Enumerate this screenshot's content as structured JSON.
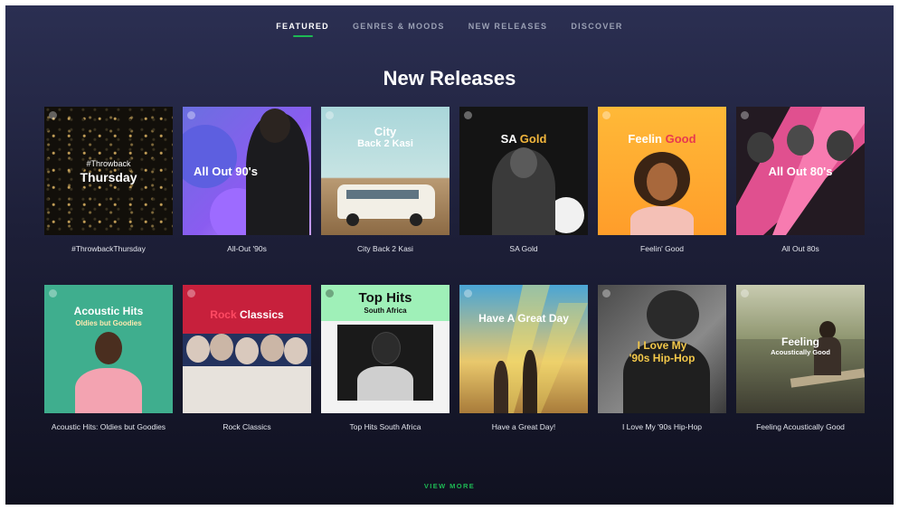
{
  "nav": {
    "items": [
      {
        "label": "FEATURED",
        "active": true
      },
      {
        "label": "GENRES & MOODS",
        "active": false
      },
      {
        "label": "NEW RELEASES",
        "active": false
      },
      {
        "label": "DISCOVER",
        "active": false
      }
    ]
  },
  "page": {
    "title": "New Releases",
    "view_more": "VIEW MORE"
  },
  "colors": {
    "accent": "#1db954",
    "background_top": "#2b2f52",
    "background_bottom": "#101120"
  },
  "covers": {
    "throwback_line1": "#Throwback",
    "throwback_line2": "Thursday",
    "allout90s": "All Out 90's",
    "city_line1": "City",
    "city_line2": "Back 2 Kasi",
    "sagold_a": "SA",
    "sagold_b": "Gold",
    "feelin_a": "Feelin",
    "feelin_b": "Good",
    "allout80s": "All Out 80's",
    "acoustic_line1": "Acoustic Hits",
    "acoustic_line2": "Oldies but Goodies",
    "rock_a": "Rock",
    "rock_b": "Classics",
    "tophits_line1": "Top Hits",
    "tophits_line2": "South Africa",
    "greatday": "Have A Great Day",
    "hiphop_line1": "I Love My",
    "hiphop_line2": "'90s Hip-Hop",
    "feeling_line1": "Feeling",
    "feeling_line2": "Acoustically Good"
  },
  "playlists": [
    "#ThrowbackThursday",
    "All-Out '90s",
    "City Back 2 Kasi",
    "SA Gold",
    "Feelin' Good",
    "All Out 80s",
    "Acoustic Hits: Oldies but Goodies",
    "Rock Classics",
    "Top Hits South Africa",
    "Have a Great Day!",
    "I Love My '90s Hip-Hop",
    "Feeling Acoustically Good"
  ]
}
